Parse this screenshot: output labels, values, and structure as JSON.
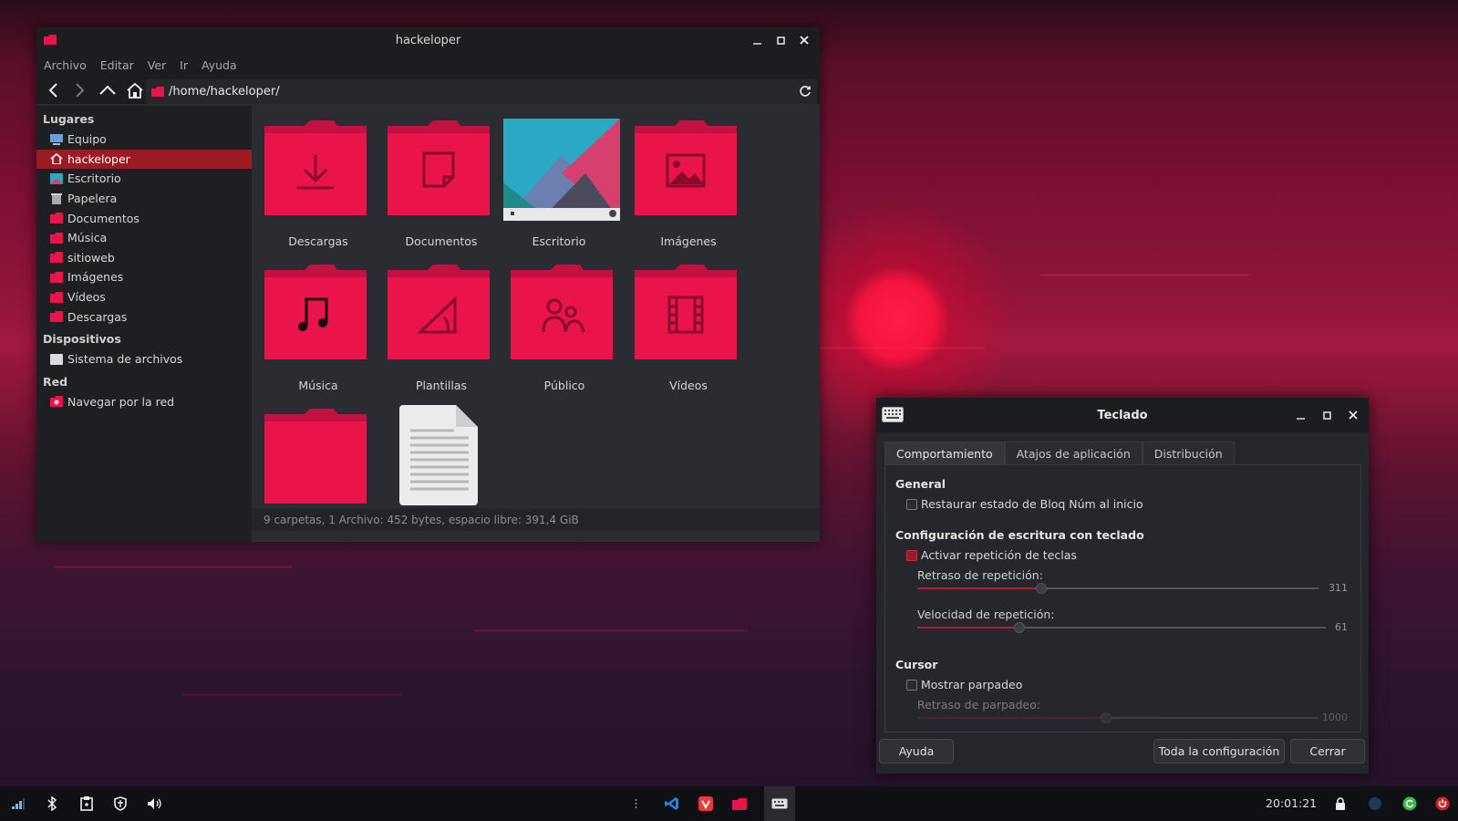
{
  "file_manager": {
    "title": "hackeloper",
    "menu": [
      "Archivo",
      "Editar",
      "Ver",
      "Ir",
      "Ayuda"
    ],
    "path": "/home/hackeloper/",
    "sidebar": {
      "places_header": "Lugares",
      "places": [
        {
          "label": "Equipo",
          "icon": "computer-icon",
          "selected": false
        },
        {
          "label": "hackeloper",
          "icon": "home-icon",
          "selected": true
        },
        {
          "label": "Escritorio",
          "icon": "desktop-icon",
          "selected": false
        },
        {
          "label": "Papelera",
          "icon": "trash-icon",
          "selected": false
        },
        {
          "label": "Documentos",
          "icon": "folder-icon",
          "selected": false
        },
        {
          "label": "Música",
          "icon": "folder-icon",
          "selected": false
        },
        {
          "label": "sitioweb",
          "icon": "folder-icon",
          "selected": false
        },
        {
          "label": "Imágenes",
          "icon": "folder-icon",
          "selected": false
        },
        {
          "label": "Vídeos",
          "icon": "folder-icon",
          "selected": false
        },
        {
          "label": "Descargas",
          "icon": "folder-icon",
          "selected": false
        }
      ],
      "devices_header": "Dispositivos",
      "devices": [
        {
          "label": "Sistema de archivos",
          "icon": "drive-icon"
        }
      ],
      "network_header": "Red",
      "network": [
        {
          "label": "Navegar por la red",
          "icon": "network-folder-icon"
        }
      ]
    },
    "items": [
      {
        "label": "Descargas",
        "icon": "download-folder-icon"
      },
      {
        "label": "Documentos",
        "icon": "documents-folder-icon"
      },
      {
        "label": "Escritorio",
        "icon": "desktop-wallpaper-icon"
      },
      {
        "label": "Imágenes",
        "icon": "pictures-folder-icon"
      },
      {
        "label": "Música",
        "icon": "music-folder-icon"
      },
      {
        "label": "Plantillas",
        "icon": "templates-folder-icon"
      },
      {
        "label": "Público",
        "icon": "public-folder-icon"
      },
      {
        "label": "Vídeos",
        "icon": "videos-folder-icon"
      },
      {
        "label": "",
        "icon": "folder-icon"
      },
      {
        "label": "",
        "icon": "text-file-icon"
      }
    ],
    "status": "9 carpetas, 1 Archivo: 452 bytes, espacio libre: 391,4 GiB"
  },
  "keyboard_dialog": {
    "title": "Teclado",
    "tabs": [
      "Comportamiento",
      "Atajos de aplicación",
      "Distribución"
    ],
    "active_tab": "Comportamiento",
    "general_header": "General",
    "numlock_label": "Restaurar estado de Bloq Núm al inicio",
    "numlock_checked": false,
    "typing_header": "Configuración de escritura con teclado",
    "repeat_label": "Activar repetición de teclas",
    "repeat_checked": true,
    "repeat_delay_label": "Retraso de repetición:",
    "repeat_delay_value": "311",
    "repeat_delay_fraction": 0.31,
    "repeat_speed_label": "Velocidad de repetición:",
    "repeat_speed_value": "61",
    "repeat_speed_fraction": 0.25,
    "cursor_header": "Cursor",
    "blink_label": "Mostrar parpadeo",
    "blink_checked": false,
    "blink_delay_label": "Retraso de parpadeo:",
    "blink_delay_value": "1000",
    "blink_delay_fraction": 0.47,
    "help_button": "Ayuda",
    "all_settings_button": "Toda la configuración",
    "close_button": "Cerrar"
  },
  "taskbar": {
    "clock": "20:01:21",
    "left_icons": [
      "network-signal-icon",
      "bluetooth-icon",
      "clipboard-icon",
      "shield-icon",
      "volume-icon"
    ],
    "apps": [
      "vscode-icon",
      "vivaldi-icon",
      "file-manager-icon",
      "keyboard-icon"
    ],
    "right_icons": [
      "lock-icon",
      "weather-icon",
      "update-icon",
      "power-icon"
    ]
  },
  "colors": {
    "accent": "#e8144a",
    "selection": "#9c1a24",
    "panel": "#2b2c31",
    "titlebar": "#1c1d21"
  }
}
